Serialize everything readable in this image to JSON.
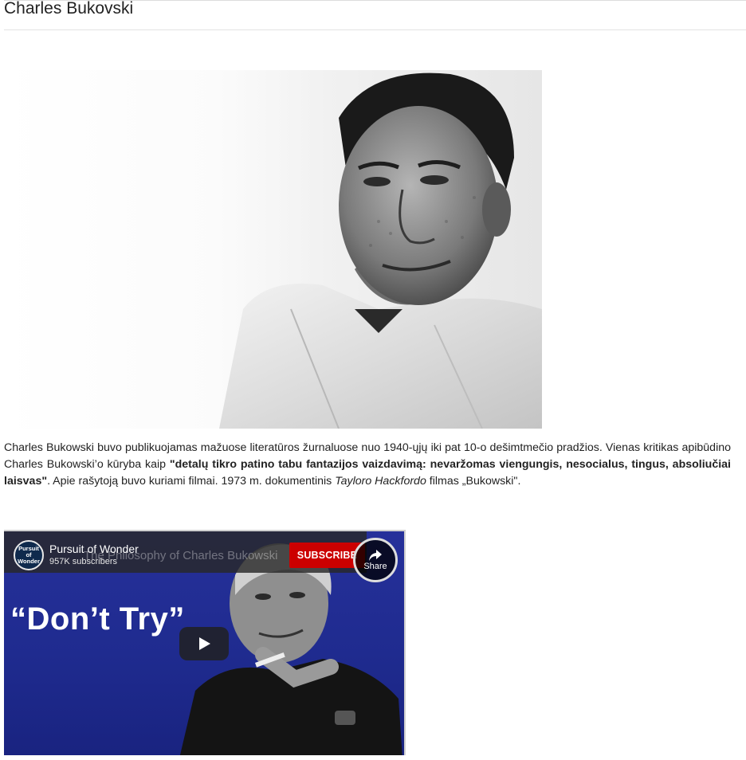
{
  "page": {
    "title": "Charles Bukovski"
  },
  "photo": {
    "subject": "Charles Bukowski portrait"
  },
  "article": {
    "p1_a": "Charles Bukowski buvo publikuojamas mažuose literatūros žurnaluose nuo 1940-ųjų iki pat 10-o dešimtmečio pradžios. Vienas kritikas apibūdino Charles Bukowski’o kūryba kaip ",
    "p1_bold": "\"detalų tikro patino tabu fantazijos vaizdavimą: nevaržomas viengungis, nesocialus, tingus, absoliučiai laisvas\"",
    "p1_b": ". Apie rašytoją buvo kuriami filmai. 1973 m. dokumentinis ",
    "p1_italic": "Tayloro Hackfordo",
    "p1_c": " filmas „Bukowski\"."
  },
  "video": {
    "ghost_title": "The Philosophy of Charles Bukowski",
    "channel_avatar_text": "Pursuit of Wonder",
    "channel_name": "Pursuit of Wonder",
    "subscribers": "957K subscribers",
    "subscribe_label": "SUBSCRIBE",
    "share_label": "Share",
    "headline": "“Don’t Try”",
    "colors": {
      "background": "#1f2b8f",
      "subscribe": "#cc0000"
    },
    "icons": [
      "play-icon",
      "share-icon"
    ]
  }
}
